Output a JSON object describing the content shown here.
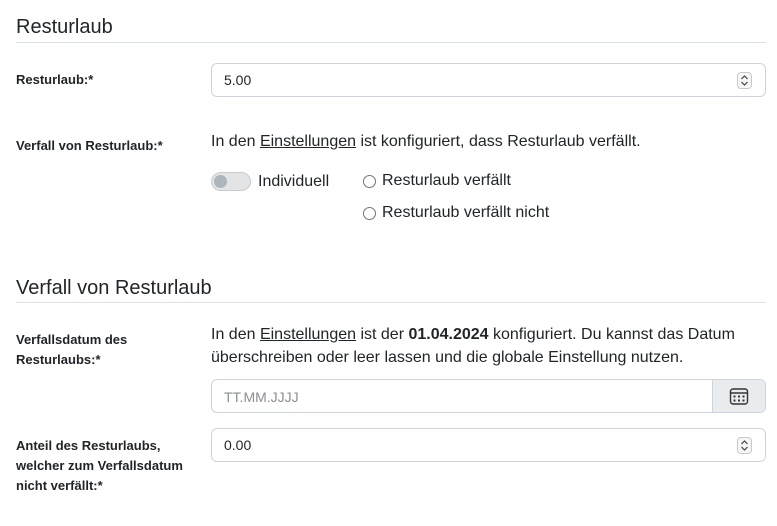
{
  "section1": {
    "title": "Resturlaub"
  },
  "resturlaub": {
    "label": "Resturlaub:*",
    "value": "5.00"
  },
  "verfall": {
    "label": "Verfall von Resturlaub:*",
    "info_prefix": "In den ",
    "info_link": "Einstellungen",
    "info_suffix": " ist konfiguriert, dass Resturlaub verfällt.",
    "toggle_label": "Individuell",
    "toggle_on": false,
    "radio_options": [
      "Resturlaub verfällt",
      "Resturlaub verfällt nicht"
    ]
  },
  "section2": {
    "title": "Verfall von Resturlaub"
  },
  "verfallsdatum": {
    "label": "Verfallsdatum des Resturlaubs:*",
    "info_prefix": "In den ",
    "info_link": "Einstellungen",
    "info_middle": " ist der ",
    "info_date": "01.04.2024",
    "info_suffix": " konfiguriert. Du kannst das Datum",
    "info_line2": "überschreiben oder leer lassen und die globale Einstellung nutzen.",
    "placeholder": "TT.MM.JJJJ",
    "button_icon": "calendar-icon"
  },
  "anteil": {
    "label": "Anteil des Resturlaubs, welcher zum Verfallsdatum nicht verfällt:*",
    "value": "0.00"
  }
}
